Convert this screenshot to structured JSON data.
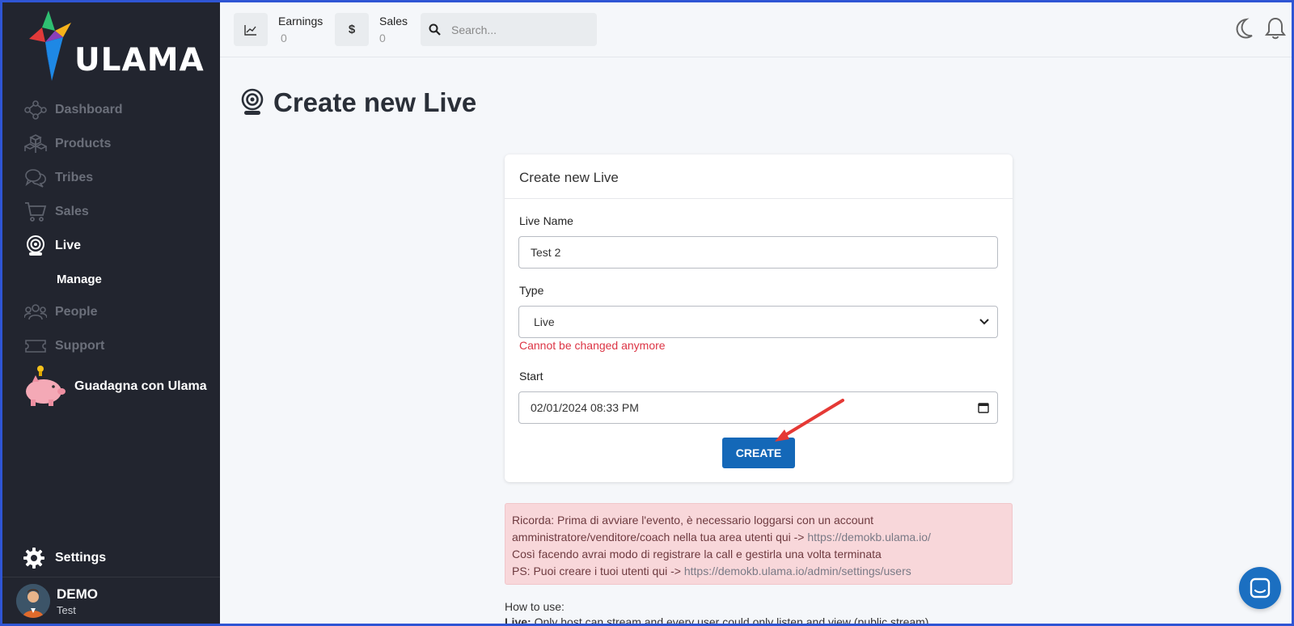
{
  "brand": {
    "name": "ULAMA"
  },
  "sidebar": {
    "items": [
      {
        "label": "Dashboard",
        "icon": "network-icon"
      },
      {
        "label": "Products",
        "icon": "cubes-icon"
      },
      {
        "label": "Tribes",
        "icon": "comments-icon"
      },
      {
        "label": "Sales",
        "icon": "cart-icon"
      },
      {
        "label": "Live",
        "icon": "webcam-icon"
      }
    ],
    "sub_item": "Manage",
    "items_after": [
      {
        "label": "People",
        "icon": "users-icon"
      },
      {
        "label": "Support",
        "icon": "ticket-icon"
      }
    ],
    "earn_label": "Guadagna con Ulama",
    "settings_label": "Settings",
    "user": {
      "name": "DEMO",
      "role": "Test"
    }
  },
  "topbar": {
    "earnings": {
      "label": "Earnings",
      "value": "0"
    },
    "sales": {
      "label": "Sales",
      "value": "0"
    },
    "search_placeholder": "Search..."
  },
  "main": {
    "title": "Create new Live",
    "card": {
      "header": "Create new Live",
      "live_name_label": "Live Name",
      "live_name_value": "Test 2",
      "type_label": "Type",
      "type_value": "Live",
      "type_error": "Cannot be changed anymore",
      "start_label": "Start",
      "start_value": "02/01/2024 08:33 PM",
      "create_label": "CREATE"
    },
    "alert": {
      "line1": "Ricorda: Prima di avviare l'evento, è necessario loggarsi con un account",
      "line2_text": "amministratore/venditore/coach nella tua area utenti qui -> ",
      "line2_link": "https://demokb.ulama.io/",
      "line3": "Così facendo avrai modo di registrare la call e gestirla una volta terminata",
      "line4_text": "PS: Puoi creare i tuoi utenti qui -> ",
      "line4_link": "https://demokb.ulama.io/admin/settings/users"
    },
    "howto": {
      "title": "How to use:",
      "live_term": "Live:",
      "live_desc": " Only host can stream and every user could only listen and view (public stream)"
    }
  },
  "colors": {
    "sidebar_bg": "#22252f",
    "primary": "#1468b8",
    "error": "#dc3545",
    "alert_bg": "#f8d7da"
  }
}
